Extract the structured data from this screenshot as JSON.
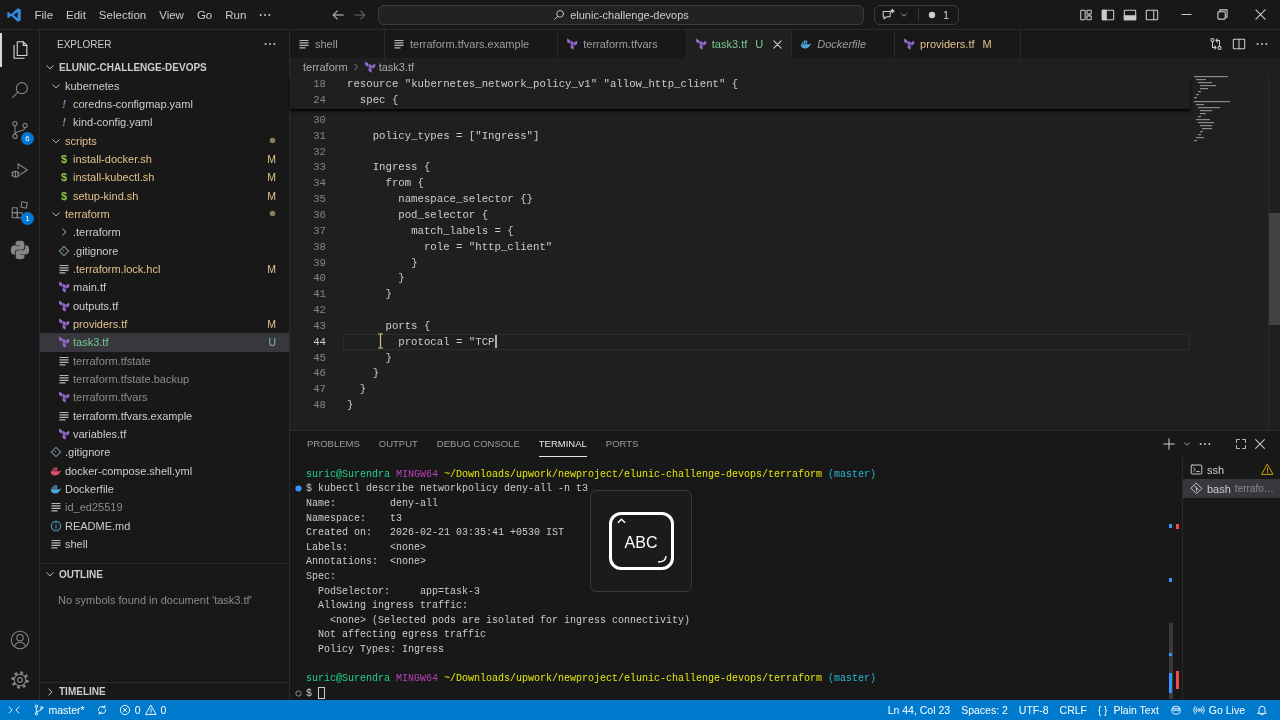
{
  "title_bar": {
    "menu": [
      {
        "label": "File"
      },
      {
        "label": "Edit"
      },
      {
        "label": "Selection"
      },
      {
        "label": "View"
      },
      {
        "label": "Go"
      },
      {
        "label": "Run"
      }
    ],
    "search": "elunic-challenge-devops",
    "chat_count": "1"
  },
  "activity_bar": {
    "items": [
      {
        "kind": "explorer",
        "selected": true
      },
      {
        "kind": "search",
        "selected": false
      },
      {
        "kind": "source-control",
        "selected": false,
        "badge": "6"
      },
      {
        "kind": "run-debug",
        "selected": false
      },
      {
        "kind": "extensions",
        "selected": false,
        "badge": "1"
      },
      {
        "kind": "python",
        "selected": false
      }
    ],
    "bottom": [
      {
        "kind": "account"
      },
      {
        "kind": "settings"
      }
    ]
  },
  "sidebar": {
    "title": "EXPLORER",
    "root": {
      "name": "ELUNIC-CHALLENGE-DEVOPS",
      "expanded": true
    },
    "tree": [
      {
        "name": "kubernetes",
        "kind": "folder",
        "expanded": true,
        "selected": false,
        "modified": false,
        "untracked": false,
        "ignored": false,
        "children": [
          {
            "name": "coredns-configmap.yaml",
            "kind": "yaml",
            "glyph": "!",
            "selected": false,
            "modified": false,
            "untracked": false,
            "ignored": false
          },
          {
            "name": "kind-config.yaml",
            "kind": "yaml",
            "glyph": "!",
            "selected": false,
            "modified": false,
            "untracked": false,
            "ignored": false
          }
        ]
      },
      {
        "name": "scripts",
        "kind": "folder",
        "expanded": true,
        "selected": false,
        "modified": true,
        "untracked": false,
        "ignored": false,
        "children": [
          {
            "name": "install-docker.sh",
            "kind": "shell",
            "glyph": "$",
            "selected": false,
            "modified": true,
            "untracked": false,
            "ignored": false,
            "badge": "M"
          },
          {
            "name": "install-kubectl.sh",
            "kind": "shell",
            "glyph": "$",
            "selected": false,
            "modified": true,
            "untracked": false,
            "ignored": false,
            "badge": "M"
          },
          {
            "name": "setup-kind.sh",
            "kind": "shell",
            "glyph": "$",
            "selected": false,
            "modified": true,
            "untracked": false,
            "ignored": false,
            "badge": "M"
          }
        ]
      },
      {
        "name": "terraform",
        "kind": "folder",
        "expanded": true,
        "selected": false,
        "modified": true,
        "untracked": false,
        "ignored": false,
        "children": [
          {
            "name": ".terraform",
            "kind": "folder",
            "expanded": false,
            "selected": false,
            "modified": false,
            "untracked": false,
            "ignored": false
          },
          {
            "name": ".gitignore",
            "kind": "gitignore",
            "selected": false,
            "modified": false,
            "untracked": false,
            "ignored": false
          },
          {
            "name": ".terraform.lock.hcl",
            "kind": "text",
            "selected": false,
            "modified": true,
            "untracked": false,
            "ignored": false,
            "badge": "M"
          },
          {
            "name": "main.tf",
            "kind": "terraform",
            "selected": false,
            "modified": false,
            "untracked": false,
            "ignored": false
          },
          {
            "name": "outputs.tf",
            "kind": "terraform",
            "selected": false,
            "modified": false,
            "untracked": false,
            "ignored": false
          },
          {
            "name": "providers.tf",
            "kind": "terraform",
            "selected": false,
            "modified": true,
            "untracked": false,
            "ignored": false,
            "badge": "M"
          },
          {
            "name": "task3.tf",
            "kind": "terraform",
            "selected": true,
            "modified": false,
            "untracked": true,
            "ignored": false,
            "badge": "U"
          },
          {
            "name": "terraform.tfstate",
            "kind": "text",
            "selected": false,
            "modified": false,
            "untracked": false,
            "ignored": true
          },
          {
            "name": "terraform.tfstate.backup",
            "kind": "text",
            "selected": false,
            "modified": false,
            "untracked": false,
            "ignored": true
          },
          {
            "name": "terraform.tfvars",
            "kind": "terraform",
            "selected": false,
            "modified": false,
            "untracked": false,
            "ignored": true
          },
          {
            "name": "terraform.tfvars.example",
            "kind": "text",
            "selected": false,
            "modified": false,
            "untracked": false,
            "ignored": false
          },
          {
            "name": "variables.tf",
            "kind": "terraform",
            "selected": false,
            "modified": false,
            "untracked": false,
            "ignored": false
          }
        ]
      },
      {
        "name": ".gitignore",
        "kind": "gitignore",
        "selected": false,
        "modified": false,
        "untracked": false,
        "ignored": false
      },
      {
        "name": "docker-compose.shell.yml",
        "kind": "compose",
        "selected": false,
        "modified": false,
        "untracked": false,
        "ignored": false
      },
      {
        "name": "Dockerfile",
        "kind": "docker",
        "selected": false,
        "modified": false,
        "untracked": false,
        "ignored": false
      },
      {
        "name": "id_ed25519",
        "kind": "text",
        "selected": false,
        "modified": false,
        "untracked": false,
        "ignored": true
      },
      {
        "name": "README.md",
        "kind": "info",
        "selected": false,
        "modified": false,
        "untracked": false,
        "ignored": false
      },
      {
        "name": "shell",
        "kind": "text",
        "selected": false,
        "modified": false,
        "untracked": false,
        "ignored": false
      }
    ],
    "outline": {
      "title": "OUTLINE",
      "expanded": true,
      "message": "No symbols found in document 'task3.tf'"
    },
    "timeline": {
      "title": "TIMELINE",
      "expanded": false
    }
  },
  "editor": {
    "tabs": [
      {
        "label": "shell",
        "kind": "text",
        "selected": false,
        "preview": false,
        "modified": false,
        "untracked": false
      },
      {
        "label": "terraform.tfvars.example",
        "kind": "text",
        "selected": false,
        "preview": false,
        "modified": false,
        "untracked": false
      },
      {
        "label": "terraform.tfvars",
        "kind": "terraform",
        "selected": false,
        "preview": false,
        "modified": false,
        "untracked": false
      },
      {
        "label": "task3.tf",
        "kind": "terraform",
        "selected": true,
        "preview": false,
        "modified": false,
        "untracked": true,
        "badge": "U"
      },
      {
        "label": "Dockerfile",
        "kind": "docker",
        "selected": false,
        "preview": true,
        "modified": false,
        "untracked": false
      },
      {
        "label": "providers.tf",
        "kind": "terraform",
        "selected": false,
        "preview": false,
        "modified": true,
        "untracked": false,
        "badge": "M"
      }
    ],
    "breadcrumb": [
      {
        "label": "terraform",
        "kind": "folder"
      },
      {
        "label": "task3.tf",
        "kind": "terraform"
      }
    ],
    "sticky_lines": [
      {
        "number": "18",
        "text": "resource \"kubernetes_network_policy_v1\" \"allow_http_client\" {"
      },
      {
        "number": "24",
        "text": "  spec {"
      }
    ],
    "lines": [
      {
        "number": "30",
        "current": false
      },
      {
        "number": "31",
        "text": "    policy_types = [\"Ingress\"]",
        "current": false
      },
      {
        "number": "32",
        "current": false
      },
      {
        "number": "33",
        "text": "    Ingress {",
        "current": false
      },
      {
        "number": "34",
        "text": "      from {",
        "current": false
      },
      {
        "number": "35",
        "text": "        namespace_selector {}",
        "current": false
      },
      {
        "number": "36",
        "text": "        pod_selector {",
        "current": false
      },
      {
        "number": "37",
        "text": "          match_labels = {",
        "current": false
      },
      {
        "number": "38",
        "text": "            role = \"http_client\"",
        "current": false
      },
      {
        "number": "39",
        "text": "          }",
        "current": false
      },
      {
        "number": "40",
        "text": "        }",
        "current": false
      },
      {
        "number": "41",
        "text": "      }",
        "current": false
      },
      {
        "number": "42",
        "current": false
      },
      {
        "number": "43",
        "text": "      ports {",
        "current": false
      },
      {
        "number": "44",
        "text": "        protocal = \"TCP",
        "current": true
      },
      {
        "number": "45",
        "text": "      }",
        "current": false
      },
      {
        "number": "46",
        "text": "    }",
        "current": false
      },
      {
        "number": "47",
        "text": "  }",
        "current": false
      },
      {
        "number": "48",
        "text": "}",
        "current": false
      }
    ]
  },
  "panel": {
    "tabs": [
      {
        "label": "PROBLEMS",
        "selected": false
      },
      {
        "label": "OUTPUT",
        "selected": false
      },
      {
        "label": "DEBUG CONSOLE",
        "selected": false
      },
      {
        "label": "TERMINAL",
        "selected": true
      },
      {
        "label": "PORTS",
        "selected": false
      }
    ],
    "terminal": {
      "lines": [
        {
          "kind": "prompt",
          "user": "suric@Surendra",
          "host": "MINGW64",
          "path": "~/Downloads/upwork/newproject/elunic-challenge-devops/terraform",
          "branch": "(master)"
        },
        {
          "kind": "command",
          "succeeded": true,
          "text": "$ kubectl describe networkpolicy deny-all -n t3",
          "cursor": false
        },
        {
          "kind": "output",
          "text": "Name:         deny-all"
        },
        {
          "kind": "output",
          "text": "Namespace:    t3"
        },
        {
          "kind": "output",
          "text": "Created on:   2026-02-21 03:35:41 +0530 IST"
        },
        {
          "kind": "output",
          "text": "Labels:       <none>"
        },
        {
          "kind": "output",
          "text": "Annotations:  <none>"
        },
        {
          "kind": "output",
          "text": "Spec:"
        },
        {
          "kind": "output",
          "text": "  PodSelector:     app=task-3"
        },
        {
          "kind": "output",
          "text": "  Allowing ingress traffic:"
        },
        {
          "kind": "output",
          "text": "    <none> (Selected pods are isolated for ingress connectivity)"
        },
        {
          "kind": "output",
          "text": "  Not affecting egress traffic"
        },
        {
          "kind": "output",
          "text": "  Policy Types: Ingress"
        },
        {
          "kind": "blank"
        },
        {
          "kind": "prompt",
          "user": "suric@Surendra",
          "host": "MINGW64",
          "path": "~/Downloads/upwork/newproject/elunic-challenge-devops/terraform",
          "branch": "(master)"
        },
        {
          "kind": "command",
          "succeeded": false,
          "text": "$",
          "cursor": true
        }
      ]
    },
    "sessions": [
      {
        "name": "ssh",
        "kind": "ssh",
        "selected": false,
        "warning": true
      },
      {
        "name": "bash",
        "detail": "terrafo…",
        "kind": "bash",
        "selected": true,
        "warning": false
      }
    ]
  },
  "status_bar": {
    "branch": "master*",
    "errors": "0",
    "warnings": "0",
    "position": "Ln 44, Col 23",
    "indentation": "Spaces: 2",
    "encoding": "UTF-8",
    "eol": "CRLF",
    "language_glyph": "{ }",
    "language": "Plain Text",
    "live": "Go Live"
  },
  "input_indicator": {
    "label": "ABC"
  }
}
